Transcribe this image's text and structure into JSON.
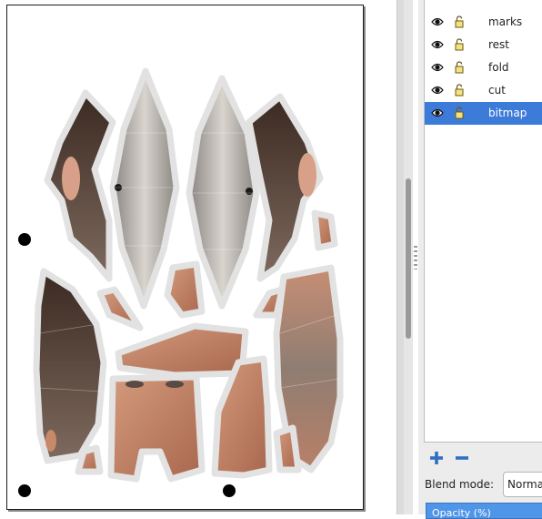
{
  "layers": {
    "items": [
      {
        "label": "marks",
        "visible": true,
        "locked": false,
        "selected": false
      },
      {
        "label": "rest",
        "visible": true,
        "locked": false,
        "selected": false
      },
      {
        "label": "fold",
        "visible": true,
        "locked": false,
        "selected": false
      },
      {
        "label": "cut",
        "visible": true,
        "locked": false,
        "selected": false
      },
      {
        "label": "bitmap",
        "visible": true,
        "locked": false,
        "selected": true
      }
    ],
    "add_icon": "plus-icon",
    "remove_icon": "minus-icon"
  },
  "blend": {
    "label": "Blend mode:",
    "value": "Normal"
  },
  "opacity": {
    "label": "Opacity (%)"
  },
  "colors": {
    "selection": "#3d7bd9",
    "add_button": "#2f6fc2",
    "skin": "#c8896b",
    "hair": "#6e5a4e"
  }
}
